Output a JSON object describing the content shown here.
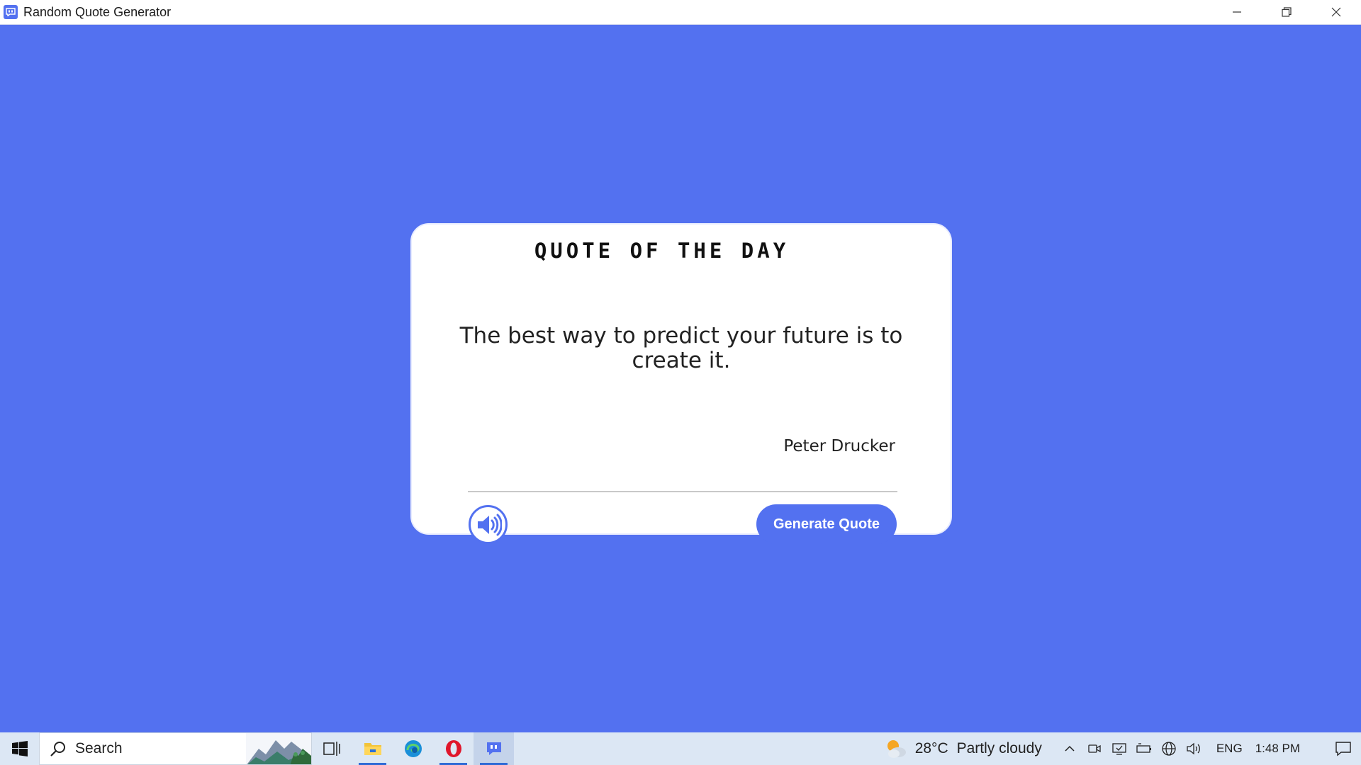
{
  "window": {
    "title": "Random Quote Generator",
    "app_icon": "quote-bubble-icon",
    "controls": [
      "minimize-icon",
      "restore-icon",
      "close-icon"
    ]
  },
  "card": {
    "heading": "QUOTE OF THE DAY",
    "quote": "The best way to predict your future is to create it.",
    "author": "Peter Drucker",
    "speak_icon": "speaker-icon",
    "generate_label": "Generate Quote"
  },
  "taskbar": {
    "search_label": "Search",
    "weather_temp": "28°C",
    "weather_condition": "Partly cloudy",
    "language": "ENG",
    "time": "1:48 PM",
    "pinned": [
      "task-view-icon",
      "file-explorer-icon",
      "edge-icon",
      "opera-icon",
      "quote-app-icon"
    ]
  },
  "colors": {
    "background": "#5371f0",
    "card": "#ffffff",
    "accent": "#5371f0"
  }
}
